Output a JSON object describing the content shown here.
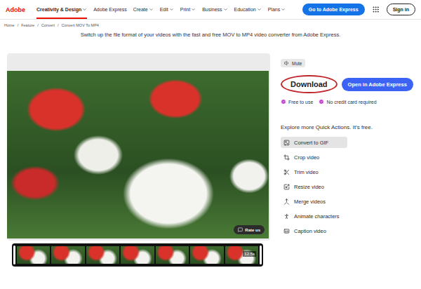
{
  "nav": {
    "logo": "Adobe",
    "items": [
      {
        "label": "Creativity & Design",
        "selected": true,
        "dropdown": true
      },
      {
        "label": "Adobe Express",
        "selected": false,
        "dropdown": false
      },
      {
        "label": "Create",
        "selected": false,
        "dropdown": true
      },
      {
        "label": "Edit",
        "selected": false,
        "dropdown": true
      },
      {
        "label": "Print",
        "selected": false,
        "dropdown": true
      },
      {
        "label": "Business",
        "selected": false,
        "dropdown": true
      },
      {
        "label": "Education",
        "selected": false,
        "dropdown": true
      },
      {
        "label": "Plans",
        "selected": false,
        "dropdown": true
      }
    ],
    "cta": "Go to Adobe Express",
    "signin": "Sign in"
  },
  "breadcrumb": {
    "separator": "/",
    "items": [
      "Home",
      "Feature",
      "Convert",
      "Convert MOV To MP4"
    ]
  },
  "subtitle": "Switch up the file format of your videos with the fast and free MOV to MP4 video converter from Adobe Express.",
  "player": {
    "mute": "Mute",
    "rate": "Rate us",
    "duration": "12.5s"
  },
  "actions": {
    "download": "Download",
    "download_highlighted": true,
    "open": "Open in Adobe Express"
  },
  "perks": [
    "Free to use",
    "No credit card required"
  ],
  "quick": {
    "title": "Explore more Quick Actions. It's free.",
    "items": [
      {
        "label": "Convert to GIF",
        "selected": true
      },
      {
        "label": "Crop video",
        "selected": false
      },
      {
        "label": "Trim video",
        "selected": false
      },
      {
        "label": "Resize video",
        "selected": false
      },
      {
        "label": "Merge videos",
        "selected": false
      },
      {
        "label": "Animate characters",
        "selected": false
      },
      {
        "label": "Caption video",
        "selected": false
      }
    ]
  }
}
